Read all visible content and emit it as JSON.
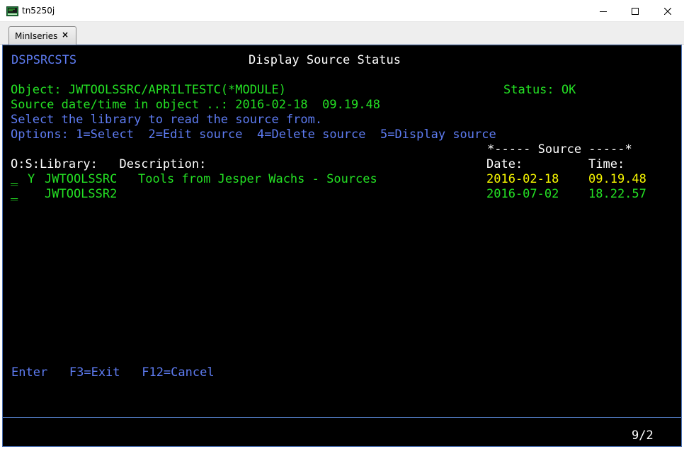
{
  "window": {
    "title": "tn5250j",
    "app_icon": "tn5250j-icon",
    "controls": {
      "minimize": "minimize-icon",
      "maximize": "maximize-icon",
      "close": "close-icon"
    }
  },
  "tabs": [
    {
      "label": "MinIseries",
      "close_glyph": "×"
    }
  ],
  "screen": {
    "program_name": "DSPSRCSTS",
    "title": "Display Source Status",
    "object_line": "Object: JWTOOLSSRC/APRILTESTC(*MODULE)",
    "status_line": "Status: OK",
    "source_datetime_line": "Source date/time in object ..: 2016-02-18  09.19.48",
    "instruction": "Select the library to read the source from.",
    "options_line": "Options: 1=Select  2=Edit source  4=Delete source  5=Display source",
    "source_group_header": "*----- Source -----*",
    "columns": {
      "left": "O:S:Library:   Description:",
      "date": "Date:",
      "time": "Time:"
    },
    "rows": [
      {
        "option": "_",
        "selected": "Y",
        "library": "JWTOOLSSRC",
        "description": "Tools from Jesper Wachs - Sources",
        "date": "2016-02-18",
        "time": "09.19.48"
      },
      {
        "option": "_",
        "selected": "",
        "library": "JWTOOLSSR2",
        "description": "",
        "date": "2016-07-02",
        "time": "18.22.57"
      }
    ],
    "function_keys": "Enter   F3=Exit   F12=Cancel",
    "cursor_position": "9/2"
  },
  "colors": {
    "terminal_bg": "#000000",
    "blue_text": "#5e7cf2",
    "green_text": "#24e024",
    "yellow_text": "#f8f800",
    "white_text": "#ffffff"
  }
}
